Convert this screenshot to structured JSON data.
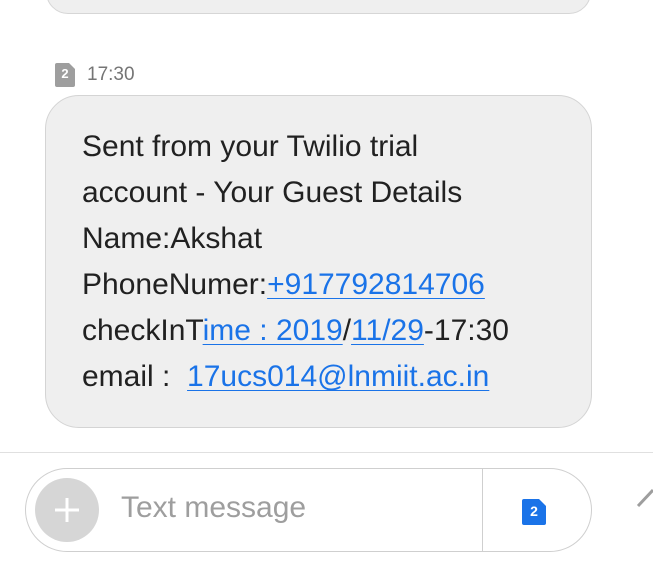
{
  "previous_message": {},
  "message": {
    "sim_number": "2",
    "timestamp": "17:30",
    "line1": "Sent from your Twilio trial",
    "line2": "account - Your Guest Details",
    "line3": "Name:Akshat",
    "line4_prefix": "PhoneNumer:",
    "line4_phone": "+917792814706",
    "line5_prefix": "checkInT",
    "line5_link1": "ime : 2019",
    "line5_sep1": "/",
    "line5_link2": "11/29",
    "line5_suffix": "-17:30",
    "line6_prefix": "email : ",
    "line6_email": "17ucs014@lnmiit.ac.in"
  },
  "composer": {
    "placeholder": "Text message",
    "add_icon": "plus-icon",
    "send_sim_number": "2",
    "send_icon": "sim-send-icon"
  },
  "colors": {
    "link": "#1a73e8",
    "bubble_bg": "#efefef",
    "sim_badge": "#9e9e9e",
    "send_sim": "#1a73e8"
  }
}
